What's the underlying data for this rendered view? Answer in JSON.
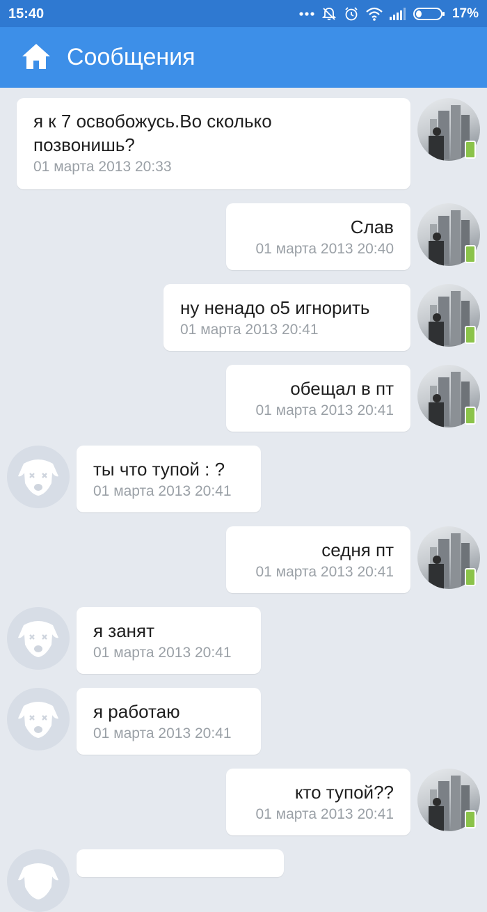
{
  "status_bar": {
    "time": "15:40",
    "battery": "17%",
    "icons": [
      "more-dots-icon",
      "bell-muted-icon",
      "alarm-icon",
      "wifi-icon",
      "signal-icon",
      "battery-icon"
    ]
  },
  "app_bar": {
    "title": "Сообщения",
    "icon": "home-icon",
    "color": "#3d8fe8"
  },
  "messages": [
    {
      "direction": "out",
      "text_lines": [
        "я к 7 освобожусь.Во сколько",
        "позвонишь?"
      ],
      "time": "01 марта 2013 20:33"
    },
    {
      "direction": "out",
      "text": "Слав",
      "time": "01 марта 2013 20:40"
    },
    {
      "direction": "out",
      "text": "ну ненадо о5 игнорить",
      "time": "01 марта 2013 20:41"
    },
    {
      "direction": "out",
      "text": "обещал в пт",
      "time": "01 марта 2013 20:41"
    },
    {
      "direction": "in",
      "text": "ты что тупой : ?",
      "time": "01 марта 2013 20:41"
    },
    {
      "direction": "out",
      "text": "седня пт",
      "time": "01 марта 2013 20:41"
    },
    {
      "direction": "in",
      "text": "я занят",
      "time": "01 марта 2013 20:41"
    },
    {
      "direction": "in",
      "text": "я работаю",
      "time": "01 марта 2013 20:41"
    },
    {
      "direction": "out",
      "text": "кто тупой??",
      "time": "01 марта 2013 20:41"
    },
    {
      "direction": "in",
      "text": "",
      "time": ""
    }
  ],
  "colors": {
    "background": "#e5e9ef",
    "status_bar": "#2f79d1",
    "bubble": "#ffffff",
    "time_text": "#9aa0a6",
    "mobile_badge": "#8bc34a"
  }
}
